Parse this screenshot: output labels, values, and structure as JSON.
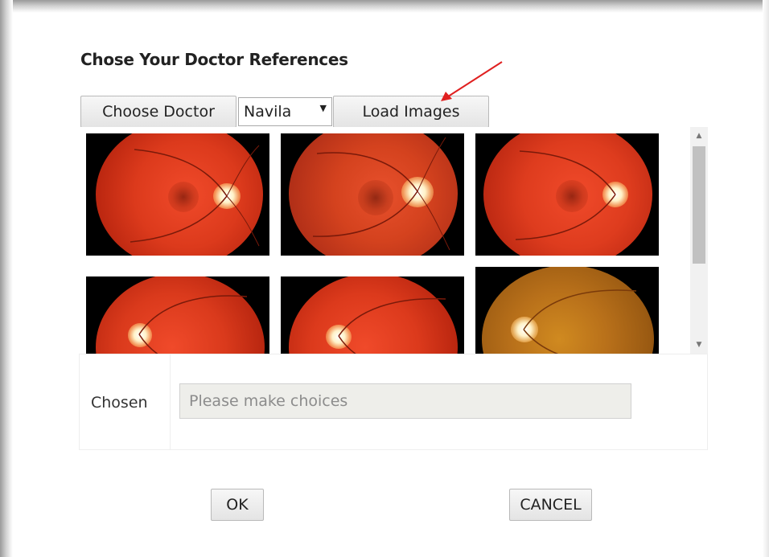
{
  "dialog": {
    "title": "Chose Your Doctor References"
  },
  "toolbar": {
    "choose_doctor_label": "Choose Doctor",
    "doctor_selected": "Navila",
    "load_images_label": "Load Images"
  },
  "gallery": {
    "images": [
      {
        "name": "fundus-image-1"
      },
      {
        "name": "fundus-image-2"
      },
      {
        "name": "fundus-image-3"
      },
      {
        "name": "fundus-image-4"
      },
      {
        "name": "fundus-image-5"
      },
      {
        "name": "fundus-image-6"
      }
    ]
  },
  "chosen": {
    "label": "Chosen",
    "placeholder": "Please make choices",
    "value": ""
  },
  "footer": {
    "ok_label": "OK",
    "cancel_label": "CANCEL"
  },
  "colors": {
    "annotation_arrow": "#e02020",
    "fundus_red": "#d8321e",
    "fundus_amber": "#b0761c"
  },
  "icons": {
    "select_arrow": "triangle-down",
    "scroll_up": "triangle-up",
    "scroll_down": "triangle-down"
  }
}
